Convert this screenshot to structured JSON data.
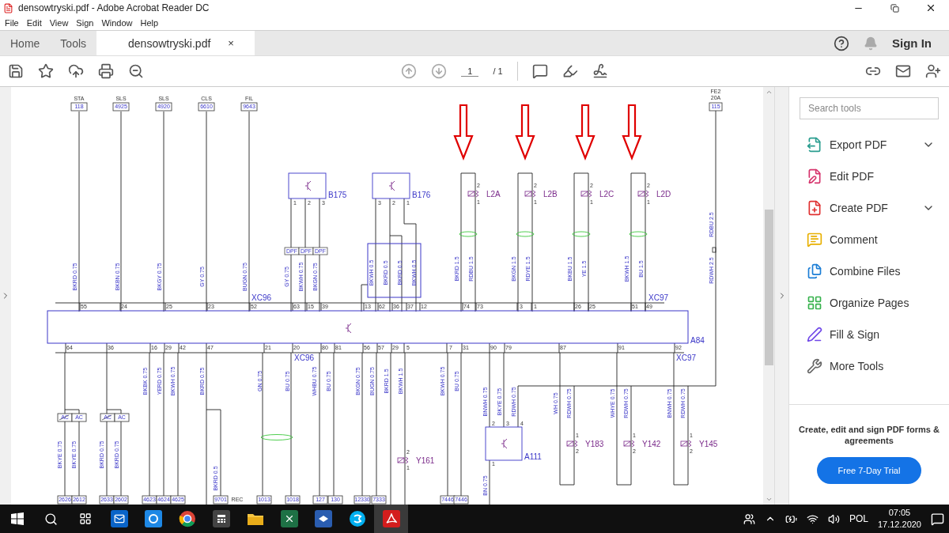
{
  "window": {
    "title": "densowtryski.pdf - Adobe Acrobat Reader DC"
  },
  "menu": [
    "File",
    "Edit",
    "View",
    "Sign",
    "Window",
    "Help"
  ],
  "tabs": [
    {
      "label": "Home",
      "selected": false
    },
    {
      "label": "Tools",
      "selected": false
    },
    {
      "label": "densowtryski.pdf",
      "selected": true,
      "close": "×"
    }
  ],
  "account": {
    "sign_in": "Sign In"
  },
  "page_nav": {
    "current": "1",
    "total": "/ 1"
  },
  "diagram": {
    "signal_terminals": [
      {
        "signal": "STA",
        "number": "118"
      },
      {
        "signal": "SLS",
        "number": "4925"
      },
      {
        "signal": "SLS",
        "number": "4920"
      },
      {
        "signal": "CLS",
        "number": "6610"
      },
      {
        "signal": "FIL",
        "number": "9643"
      },
      {
        "signal": "FE2",
        "rating": "20A",
        "number": "115"
      }
    ],
    "sensors": [
      {
        "label": "B175",
        "pins": [
          "1",
          "2",
          "3"
        ]
      },
      {
        "label": "B176",
        "pins": [
          "3",
          "2",
          "1"
        ]
      }
    ],
    "shield_labels": [
      "DPF",
      "DPF",
      "DPF"
    ],
    "injectors": [
      {
        "label": "L2A",
        "pins": [
          "2",
          "1"
        ]
      },
      {
        "label": "L2B",
        "pins": [
          "2",
          "1"
        ]
      },
      {
        "label": "L2C",
        "pins": [
          "2",
          "1"
        ]
      },
      {
        "label": "L2D",
        "pins": [
          "2",
          "1"
        ]
      }
    ],
    "upper_wire_labels": [
      "BKRD 0.75",
      "BKBN 0.75",
      "BKGY 0.75",
      "GY 0.75",
      "BUGN 0.75",
      "GY 0.75",
      "BKWH 0.75",
      "BKGN 0.75",
      "BKWH 0.5",
      "BKRD 0.5",
      "BKRD 0.5",
      "BKWH 0.5",
      "BKRD 1.5",
      "RDBU 1.5",
      "BKGN 1.5",
      "RDYE 1.5",
      "BKBU 1.5",
      "YE 1.5",
      "BKWH 1.5",
      "BU 1.5",
      "RDBU 2.5",
      "RDWH 2.5"
    ],
    "upper_pins": [
      "55",
      "24",
      "25",
      "23",
      "52",
      "63",
      "15",
      "39",
      "13",
      "62",
      "36",
      "37",
      "12",
      "74",
      "73",
      "3",
      "1",
      "26",
      "25",
      "51",
      "49"
    ],
    "connector_labels": [
      "XC96",
      "XC97",
      "XC96",
      "XC97"
    ],
    "module": {
      "label": "A84"
    },
    "lower_pins": [
      "64",
      "36",
      "16",
      "29",
      "42",
      "47",
      "21",
      "20",
      "80",
      "81",
      "56",
      "57",
      "29",
      "5",
      "7",
      "31",
      "90",
      "79",
      "87",
      "91",
      "92"
    ],
    "lower_wire_labels": [
      "BKBK 0.75",
      "YERD 0.75",
      "BKWH 0.75",
      "BKRD 0.75",
      "GN 0.75",
      "BU 0.75",
      "WHBU 0.75",
      "BU 0.75",
      "BKGN 0.75",
      "BUGN 0.75",
      "BKRD 1.5",
      "BKWH 1.5",
      "BKWH 0.75",
      "BU 0.75",
      "BNWH 0.75",
      "BKYE 0.75",
      "RDWH 0.75",
      "WH 0.75",
      "RDWH 0.75",
      "WHYE 0.75",
      "RDWH 0.75",
      "BNWH 0.75",
      "RDWH 0.75"
    ],
    "branch_wire_labels": [
      "BKYE 0.75",
      "BKYE 0.75",
      "BKRD 0.75",
      "BKRD 0.75",
      "BKRD 0.5",
      "BN 0.75"
    ],
    "switch_labels": [
      "AC",
      "AC",
      "AC",
      "AC"
    ],
    "bottom_terminals": [
      "2626",
      "2612",
      "2633",
      "2602",
      "4623",
      "4624",
      "4625",
      "9701",
      "1013",
      "1018",
      "127",
      "130",
      "12330",
      "7333",
      "7446",
      "7446"
    ],
    "rec_label": "REC",
    "valves": [
      {
        "label": "Y161",
        "pins": [
          "2",
          "1"
        ]
      },
      {
        "label": "Y183",
        "pins": [
          "1",
          "2"
        ]
      },
      {
        "label": "Y142",
        "pins": [
          "1",
          "2"
        ]
      },
      {
        "label": "Y145",
        "pins": [
          "1",
          "2"
        ]
      }
    ],
    "control_unit": {
      "label": "A111",
      "pins": [
        "2",
        "3",
        "4",
        "1"
      ]
    }
  },
  "tools_panel": {
    "search": {
      "placeholder": "Search tools"
    },
    "items": [
      {
        "label": "Export PDF",
        "expandable": true
      },
      {
        "label": "Edit PDF",
        "expandable": false
      },
      {
        "label": "Create PDF",
        "expandable": true
      },
      {
        "label": "Comment",
        "expandable": false
      },
      {
        "label": "Combine Files",
        "expandable": false
      },
      {
        "label": "Organize Pages",
        "expandable": false
      },
      {
        "label": "Fill & Sign",
        "expandable": false
      },
      {
        "label": "More Tools",
        "expandable": false
      }
    ],
    "promo": {
      "text": "Create, edit and sign PDF forms & agreements",
      "button": "Free 7-Day Trial"
    }
  },
  "taskbar": {
    "language": "POL",
    "time": "07:05",
    "date": "17.12.2020"
  }
}
